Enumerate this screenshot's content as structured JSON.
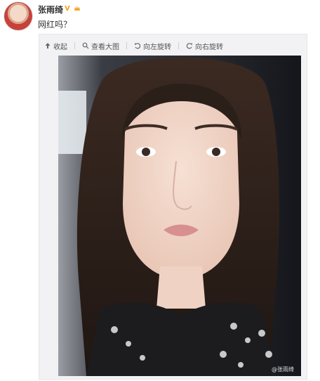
{
  "post": {
    "username": "张雨绮",
    "text": "网红吗？"
  },
  "toolbar": {
    "collapse_label": "收起",
    "view_large_label": "查看大图",
    "rotate_left_label": "向左旋转",
    "rotate_right_label": "向右旋转"
  },
  "photo": {
    "watermark": "@张雨绮"
  }
}
